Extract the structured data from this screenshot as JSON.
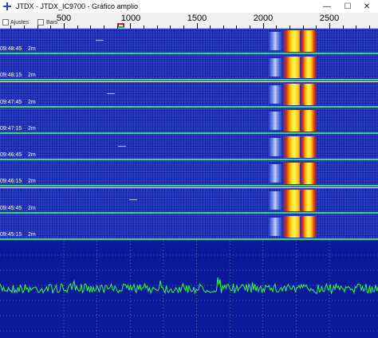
{
  "window": {
    "title": "JTDX - JTDX_IC9700 - Gráfico amplio",
    "minimize_glyph": "—",
    "maximize_glyph": "☐",
    "close_glyph": "✕"
  },
  "toolbar": {
    "ajustes_label": "Ajustes",
    "bars_label": "Bars"
  },
  "frequency_scale": {
    "labels": [
      "500",
      "1000",
      "1500",
      "2000",
      "2500"
    ]
  },
  "waterfall": {
    "rows": [
      {
        "time": "09:48:45",
        "mode": "2m"
      },
      {
        "time": "09:48:15",
        "mode": "2m"
      },
      {
        "time": "09:47:45",
        "mode": "2m"
      },
      {
        "time": "09:47:15",
        "mode": "2m"
      },
      {
        "time": "09:46:45",
        "mode": "2m"
      },
      {
        "time": "09:46:15",
        "mode": "2m"
      },
      {
        "time": "09:45:45",
        "mode": "2m"
      },
      {
        "time": "09:45:15",
        "mode": "2m"
      }
    ]
  },
  "colors": {
    "waterfall_bg": "#1e2fb3",
    "separator": "#3ad680",
    "spectrum_bg": "#0a1a9a",
    "spectrum_line": "#33ff33",
    "marker_top": "#e0102a",
    "marker_bottom": "#0bd42a"
  }
}
